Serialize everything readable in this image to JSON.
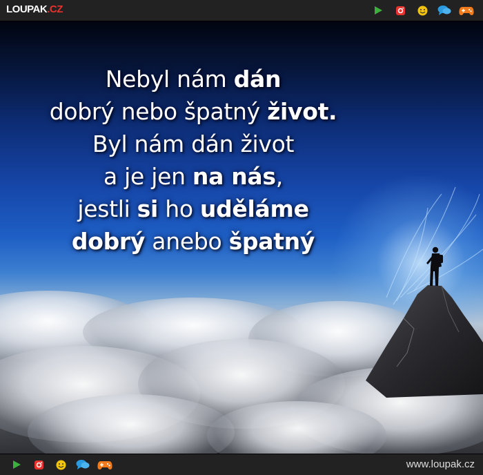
{
  "header": {
    "logo_name": "LOUPAK",
    "logo_tld": ".CZ"
  },
  "icons": [
    "play-icon",
    "instagram-icon",
    "smiley-icon",
    "chat-icon",
    "gamepad-icon"
  ],
  "colors": {
    "play": "#3cb03c",
    "instagram": "#e8322d",
    "smiley": "#f2c40f",
    "chat": "#2a9be0",
    "gamepad": "#f07a1c"
  },
  "quote": {
    "line1": [
      {
        "t": "Nebyl nám ",
        "b": false
      },
      {
        "t": "dán",
        "b": true
      }
    ],
    "line2": [
      {
        "t": "dobrý nebo špatný ",
        "b": false
      },
      {
        "t": "život.",
        "b": true
      }
    ],
    "line3": [
      {
        "t": "Byl nám dán život",
        "b": false
      }
    ],
    "line4": [
      {
        "t": "a je jen ",
        "b": false
      },
      {
        "t": "na nás",
        "b": true
      },
      {
        "t": ",",
        "b": false
      }
    ],
    "line5": [
      {
        "t": "jestli ",
        "b": false
      },
      {
        "t": "si",
        "b": true
      },
      {
        "t": " ho ",
        "b": false
      },
      {
        "t": "uděláme",
        "b": true
      }
    ],
    "line6": [
      {
        "t": "dobrý",
        "b": true
      },
      {
        "t": " anebo ",
        "b": false
      },
      {
        "t": "špatný",
        "b": true
      }
    ]
  },
  "footer": {
    "site": "www.loupak.cz"
  }
}
